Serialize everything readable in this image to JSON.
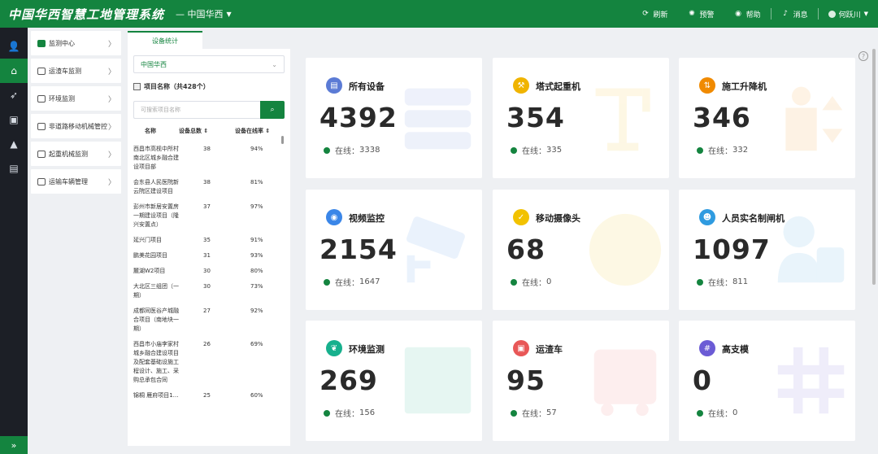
{
  "app": {
    "title": "中国华西智慧工地管理系统",
    "org": "— 中国华西"
  },
  "topbar": {
    "refresh": "刷新",
    "alarm": "预警",
    "help": "帮助",
    "message": "消息",
    "user": "何跃川"
  },
  "submenu": [
    {
      "label": "监测中心"
    },
    {
      "label": "运渣车监测"
    },
    {
      "label": "环境监测"
    },
    {
      "label": "非道路移动机械管控"
    },
    {
      "label": "起重机械监测"
    },
    {
      "label": "运输车辆管理"
    }
  ],
  "tab": {
    "label": "设备统计"
  },
  "panel": {
    "select_value": "中国华西",
    "projects_title": "项目名称（共428个）",
    "search_placeholder": "可搜索项目名称",
    "col_name": "名称",
    "col_total": "设备总数 ⇕",
    "col_rate": "设备在线率 ⇕",
    "rows": [
      {
        "name": "西昌市高枧中所村南北区城乡融合建设项目部",
        "total": "38",
        "rate": "94%"
      },
      {
        "name": "会东县人民医院新云院区建设项目",
        "total": "38",
        "rate": "81%"
      },
      {
        "name": "彭州市新居安置房一期建设项目（隆兴安置点）",
        "total": "37",
        "rate": "97%"
      },
      {
        "name": "延兴门项目",
        "total": "35",
        "rate": "91%"
      },
      {
        "name": "鹏美花园项目",
        "total": "31",
        "rate": "93%"
      },
      {
        "name": "麓湖W2项目",
        "total": "30",
        "rate": "80%"
      },
      {
        "name": "大北区三组团（一期）",
        "total": "30",
        "rate": "73%"
      },
      {
        "name": "成都同医谷产城融合项目（南地块一期）",
        "total": "27",
        "rate": "92%"
      },
      {
        "name": "西昌市小庙李家村城乡融合建设项目及配套基础设施工程设计、施工、采购总承包合同",
        "total": "26",
        "rate": "69%"
      },
      {
        "name": "锦桐 雁府项目1…",
        "total": "25",
        "rate": "60%"
      }
    ]
  },
  "online_label": "在线：",
  "cards": [
    {
      "title": "所有设备",
      "count": "4392",
      "online": "3338",
      "color": "#5b7bd5",
      "icon": "device-stack-icon"
    },
    {
      "title": "塔式起重机",
      "count": "354",
      "online": "335",
      "color": "#f0b400",
      "icon": "tower-crane-icon"
    },
    {
      "title": "施工升降机",
      "count": "346",
      "online": "332",
      "color": "#f08a00",
      "icon": "elevator-icon"
    },
    {
      "title": "视频监控",
      "count": "2154",
      "online": "1647",
      "color": "#3a86e8",
      "icon": "camera-icon"
    },
    {
      "title": "移动摄像头",
      "count": "68",
      "online": "0",
      "color": "#f2c200",
      "icon": "check-icon"
    },
    {
      "title": "人员实名制闸机",
      "count": "1097",
      "online": "811",
      "color": "#2f9be0",
      "icon": "person-card-icon"
    },
    {
      "title": "环境监测",
      "count": "269",
      "online": "156",
      "color": "#17b08d",
      "icon": "leaf-icon"
    },
    {
      "title": "运渣车",
      "count": "95",
      "online": "57",
      "color": "#e85757",
      "icon": "truck-icon"
    },
    {
      "title": "高支模",
      "count": "0",
      "online": "0",
      "color": "#6b5bd5",
      "icon": "grid-icon"
    }
  ]
}
